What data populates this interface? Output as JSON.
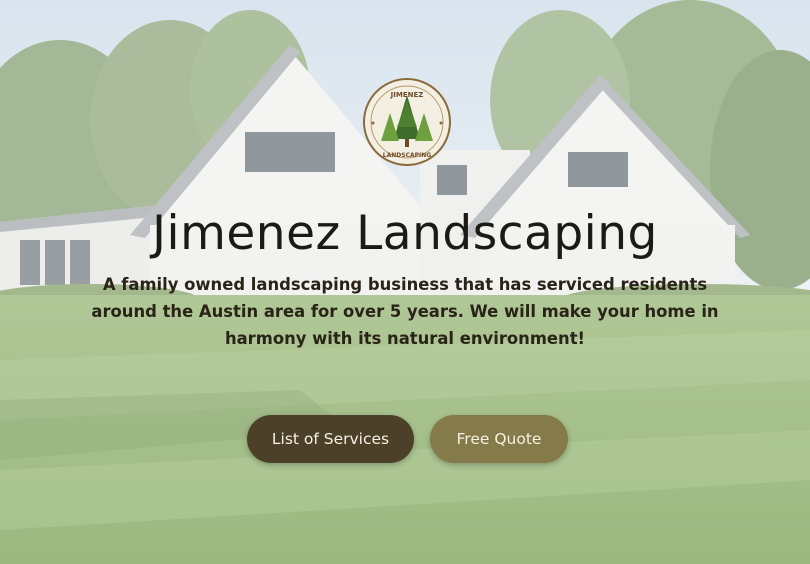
{
  "hero": {
    "logo_text_top": "JIMENEZ",
    "logo_text_bottom": "LANDSCAPING",
    "title": "Jimenez Landscaping",
    "tagline": "A family owned landscaping business that has serviced residents around the Austin area for over 5 years. We will make your home in harmony with its natural environment!"
  },
  "buttons": {
    "services_label": "List of Services",
    "quote_label": "Free Quote"
  },
  "colors": {
    "services_button": "#4c4128",
    "quote_button": "#847a4a",
    "title_text": "#1c1a14"
  }
}
